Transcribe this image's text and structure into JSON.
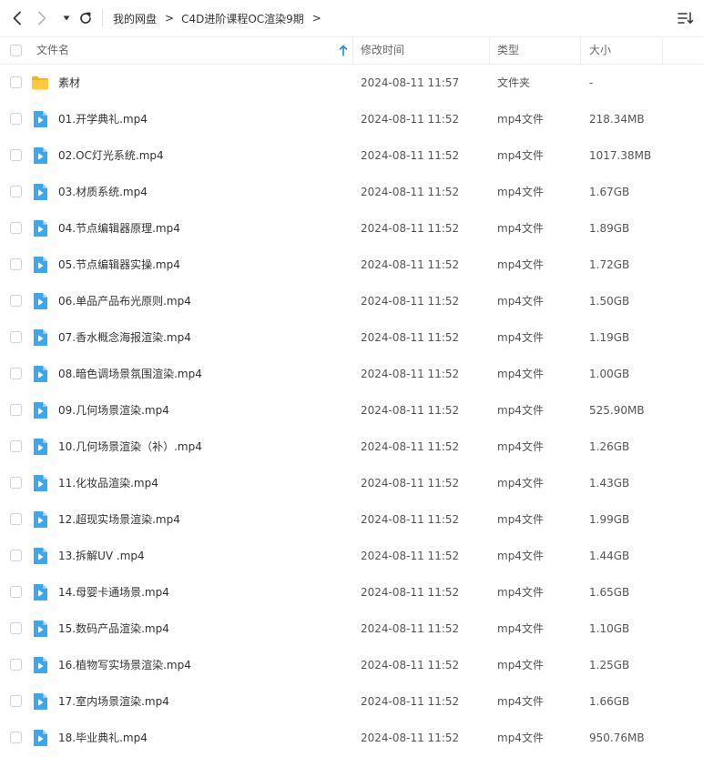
{
  "toolbar": {
    "back_icon": "chevron-left-icon",
    "forward_icon": "chevron-right-icon",
    "dropdown_icon": "caret-down-icon",
    "refresh_icon": "refresh-icon",
    "sort_menu_icon": "sort-list-icon",
    "breadcrumb": [
      "我的网盘",
      "C4D进阶课程OC渲染9期"
    ],
    "breadcrumb_separator": ">"
  },
  "columns": {
    "name": "文件名",
    "modified": "修改时间",
    "type": "类型",
    "size": "大小"
  },
  "colors": {
    "accent": "#1e88e5",
    "folder": "#ffc22e",
    "video": "#3ba7f0",
    "divider": "#ececec"
  },
  "files": [
    {
      "name": "素材",
      "date": "2024-08-11 11:57",
      "type": "文件夹",
      "size": "-",
      "kind": "folder"
    },
    {
      "name": "01.开学典礼.mp4",
      "date": "2024-08-11 11:52",
      "type": "mp4文件",
      "size": "218.34MB",
      "kind": "video"
    },
    {
      "name": "02.OC灯光系统.mp4",
      "date": "2024-08-11 11:52",
      "type": "mp4文件",
      "size": "1017.38MB",
      "kind": "video"
    },
    {
      "name": "03.材质系统.mp4",
      "date": "2024-08-11 11:52",
      "type": "mp4文件",
      "size": "1.67GB",
      "kind": "video"
    },
    {
      "name": "04.节点编辑器原理.mp4",
      "date": "2024-08-11 11:52",
      "type": "mp4文件",
      "size": "1.89GB",
      "kind": "video"
    },
    {
      "name": "05.节点编辑器实操.mp4",
      "date": "2024-08-11 11:52",
      "type": "mp4文件",
      "size": "1.72GB",
      "kind": "video"
    },
    {
      "name": "06.单品产品布光原则.mp4",
      "date": "2024-08-11 11:52",
      "type": "mp4文件",
      "size": "1.50GB",
      "kind": "video"
    },
    {
      "name": "07.香水概念海报渲染.mp4",
      "date": "2024-08-11 11:52",
      "type": "mp4文件",
      "size": "1.19GB",
      "kind": "video"
    },
    {
      "name": "08.暗色调场景氛围渲染.mp4",
      "date": "2024-08-11 11:52",
      "type": "mp4文件",
      "size": "1.00GB",
      "kind": "video"
    },
    {
      "name": "09.几何场景渲染.mp4",
      "date": "2024-08-11 11:52",
      "type": "mp4文件",
      "size": "525.90MB",
      "kind": "video"
    },
    {
      "name": "10.几何场景渲染（补）.mp4",
      "date": "2024-08-11 11:52",
      "type": "mp4文件",
      "size": "1.26GB",
      "kind": "video"
    },
    {
      "name": "11.化妆品渲染.mp4",
      "date": "2024-08-11 11:52",
      "type": "mp4文件",
      "size": "1.43GB",
      "kind": "video"
    },
    {
      "name": "12.超现实场景渲染.mp4",
      "date": "2024-08-11 11:52",
      "type": "mp4文件",
      "size": "1.99GB",
      "kind": "video"
    },
    {
      "name": "13.拆解UV .mp4",
      "date": "2024-08-11 11:52",
      "type": "mp4文件",
      "size": "1.44GB",
      "kind": "video"
    },
    {
      "name": "14.母婴卡通场景.mp4",
      "date": "2024-08-11 11:52",
      "type": "mp4文件",
      "size": "1.65GB",
      "kind": "video"
    },
    {
      "name": "15.数码产品渲染.mp4",
      "date": "2024-08-11 11:52",
      "type": "mp4文件",
      "size": "1.10GB",
      "kind": "video"
    },
    {
      "name": "16.植物写实场景渲染.mp4",
      "date": "2024-08-11 11:52",
      "type": "mp4文件",
      "size": "1.25GB",
      "kind": "video"
    },
    {
      "name": "17.室内场景渲染.mp4",
      "date": "2024-08-11 11:52",
      "type": "mp4文件",
      "size": "1.66GB",
      "kind": "video"
    },
    {
      "name": "18.毕业典礼.mp4",
      "date": "2024-08-11 11:52",
      "type": "mp4文件",
      "size": "950.76MB",
      "kind": "video"
    }
  ]
}
